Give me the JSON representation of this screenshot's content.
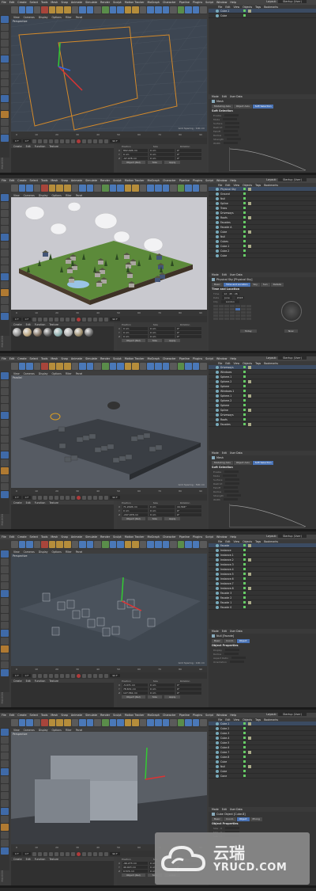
{
  "menu": [
    "File",
    "Edit",
    "Create",
    "Select",
    "Tools",
    "Mesh",
    "Snap",
    "Animate",
    "Simulate",
    "Render",
    "Sculpt",
    "Motion Tracker",
    "MoGraph",
    "Character",
    "Pipeline",
    "Plugins",
    "Script",
    "Window",
    "Help"
  ],
  "layout_label": "Layout:",
  "layout_value": "Startup (User)",
  "viewport_menu": [
    "View",
    "Cameras",
    "Display",
    "Options",
    "Filter",
    "Panel"
  ],
  "object_menu": [
    "File",
    "Edit",
    "View",
    "Objects",
    "Tags",
    "Bookmarks"
  ],
  "attr_menu": [
    "Mode",
    "Edit",
    "User Data"
  ],
  "material_menu": [
    "Create",
    "Edit",
    "Function",
    "Texture"
  ],
  "coord_headers": [
    "Position",
    "Size",
    "Rotation"
  ],
  "coord_apply": [
    "Object (Rel)",
    "Size",
    "Apply"
  ],
  "timeline_ticks": [
    "0",
    "10",
    "20",
    "30",
    "40",
    "50",
    "60",
    "70",
    "80",
    "90"
  ],
  "frame_start": "0 F",
  "frame_end": "90 F",
  "frame_cur": "0 F",
  "panels": [
    {
      "vp_label": "Perspective",
      "grid": "Grid Spacing : 100 cm",
      "objects": [
        "Cube.1",
        "Cube"
      ],
      "attr_icon": "Mesh",
      "tabs": [
        "Modeling Axis",
        "Object Axis",
        "Soft Selection"
      ],
      "active_tab": "Soft Selection",
      "section": "Soft Selection",
      "attr_rows": [
        "Enable",
        "Mode",
        "Surface",
        "Restrict",
        "Falloff",
        "Radius",
        "Strength",
        "Width"
      ],
      "coords": [
        [
          "X",
          "802.426 cm",
          "0 cm",
          "0°"
        ],
        [
          "Y",
          "0 cm",
          "0 cm",
          "0°"
        ],
        [
          "Z",
          "-97.078 cm",
          "0 cm",
          "0°"
        ]
      ]
    },
    {
      "vp_label": "",
      "grid": "",
      "objects": [
        "Physical Sky",
        "Ground",
        "Null",
        "Spline",
        "Trees",
        "Driveways",
        "Roofs",
        "Facades",
        "Facade A",
        "Cube",
        "Null",
        "Cubes",
        "Cube.1",
        "Cube.2",
        "Cube"
      ],
      "attr_icon": "Physical Sky [Physical Sky]",
      "tabs": [
        "Basic",
        "Time and Location",
        "Sky",
        "Sun",
        "Details"
      ],
      "active_tab": "Time and Location",
      "section": "Time and Location",
      "attr_rows": [
        "Time",
        "Date",
        "City"
      ],
      "time_value": "12 : 45 : 26",
      "date_month": "June",
      "date_year": "2018",
      "city": "London",
      "today": "Today",
      "now": "Now",
      "coords": [
        [
          "X",
          "0 cm",
          "0 cm",
          "0°"
        ],
        [
          "Y",
          "0 cm",
          "0 cm",
          "0°"
        ],
        [
          "Z",
          "0 cm",
          "0 cm",
          "0°"
        ]
      ]
    },
    {
      "vp_label": "Parallel",
      "grid": "Grid Spacing : 500 cm",
      "objects": [
        "Driveways",
        "Windows",
        "Sphere.1",
        "Sphere.2",
        "Sphere",
        "Windows.1",
        "Sphere.1",
        "Sphere.2",
        "Sphere",
        "Spline",
        "Driveways",
        "Roofs",
        "Facades"
      ],
      "attr_icon": "Mesh",
      "tabs": [
        "Modeling Axis",
        "Object Axis",
        "Soft Selection"
      ],
      "active_tab": "Soft Selection",
      "section": "Soft Selection",
      "attr_rows": [
        "Enable",
        "Mode",
        "Surface",
        "Restrict",
        "Falloff",
        "Radius",
        "Strength",
        "Width"
      ],
      "coords": [
        [
          "X",
          "71.2426 cm",
          "0 cm",
          "44.394°"
        ],
        [
          "Y",
          "0 cm",
          "0 cm",
          "0°"
        ],
        [
          "Z",
          "-247.078 cm",
          "0 cm",
          "0°"
        ]
      ]
    },
    {
      "vp_label": "Perspective",
      "grid": "Grid Spacing : 100 cm",
      "objects": [
        "Facade",
        "Instance",
        "Instance.1",
        "Instance.2",
        "Instance.3",
        "Instance.4",
        "Instance.5",
        "Instance.6",
        "Instance.7",
        "Instance.8",
        "Facade 3",
        "Facade 2",
        "Facade 1",
        "Facade 0"
      ],
      "attr_icon": "Null [Facade]",
      "tabs": [
        "Basic",
        "Coord.",
        "Object"
      ],
      "active_tab": "Object",
      "section": "Object Properties",
      "attr_rows": [
        "Display",
        "Radius",
        "Aspect Ratio",
        "Orientation"
      ],
      "coords": [
        [
          "X",
          "-5.071 cm",
          "0 cm",
          "0°"
        ],
        [
          "Y",
          "78.631 cm",
          "0 cm",
          "0°"
        ],
        [
          "Z",
          "127.361 cm",
          "0 cm",
          "0°"
        ]
      ]
    },
    {
      "vp_label": "Perspective",
      "grid": "",
      "objects": [
        "Cube.1",
        "Cube.2",
        "Cube.3",
        "Cube.4",
        "Cube.5",
        "Cube.6",
        "Cube.7",
        "Cube.8",
        "Cube",
        "Null",
        "Cube",
        "Cone"
      ],
      "attr_icon": "Cube Object [Cube.8]",
      "tabs": [
        "Basic",
        "Coord.",
        "Object",
        "Phong"
      ],
      "active_tab": "Object",
      "section": "Object Properties",
      "attr_rows": [
        "Size . X",
        "Size . Y",
        "Size . Z"
      ],
      "coords": [
        [
          "X",
          "-96.273 cm",
          "0 cm",
          "0°"
        ],
        [
          "Y",
          "40.023 cm",
          "0 cm",
          "0°"
        ],
        [
          "Z",
          "0.574 cm",
          "0 cm",
          "0°"
        ]
      ]
    }
  ],
  "watermark": {
    "cn": "云瑞",
    "en": "YRUCD.COM"
  }
}
